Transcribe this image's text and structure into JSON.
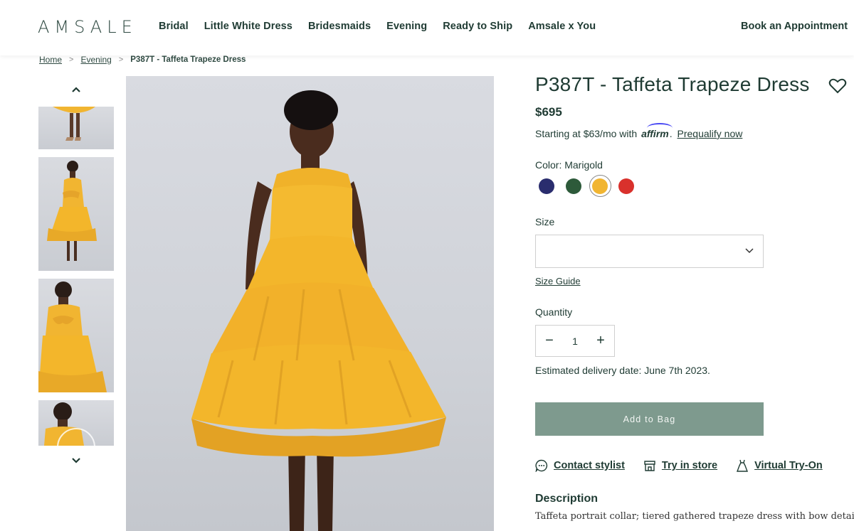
{
  "header": {
    "logo": "AMSALE",
    "nav": [
      "Bridal",
      "Little White Dress",
      "Bridesmaids",
      "Evening",
      "Ready to Ship",
      "Amsale x You"
    ],
    "book": "Book an Appointment"
  },
  "breadcrumb": {
    "home": "Home",
    "evening": "Evening",
    "current": "P387T - Taffeta Trapeze Dress"
  },
  "product": {
    "title": "P387T - Taffeta Trapeze Dress",
    "price": "$695",
    "affirm_text": "Starting at $63/mo with",
    "affirm_brand": "affirm",
    "affirm_link": "Prequalify now",
    "color_label": "Color: Marigold",
    "swatches": [
      {
        "name": "Navy",
        "hex": "#2a2d6e"
      },
      {
        "name": "Green",
        "hex": "#2d5a3a"
      },
      {
        "name": "Marigold",
        "hex": "#f1b531"
      },
      {
        "name": "Red",
        "hex": "#d9312c"
      }
    ],
    "size_label": "Size",
    "size_value": "",
    "size_guide": "Size Guide",
    "qty_label": "Quantity",
    "qty_minus": "−",
    "qty_value": "1",
    "qty_plus": "+",
    "delivery": "Estimated delivery date: June 7th 2023.",
    "add_button": "Add to Bag",
    "links": {
      "contact": "Contact stylist",
      "store": "Try in store",
      "virtual": "Virtual Try-On"
    },
    "description_heading": "Description",
    "description": "Taffeta portrait collar; tiered gathered trapeze dress with bow detail at"
  },
  "colors": {
    "brand": "#1f3b33",
    "button": "#7e9a8e",
    "dress": "#f3b62b"
  }
}
